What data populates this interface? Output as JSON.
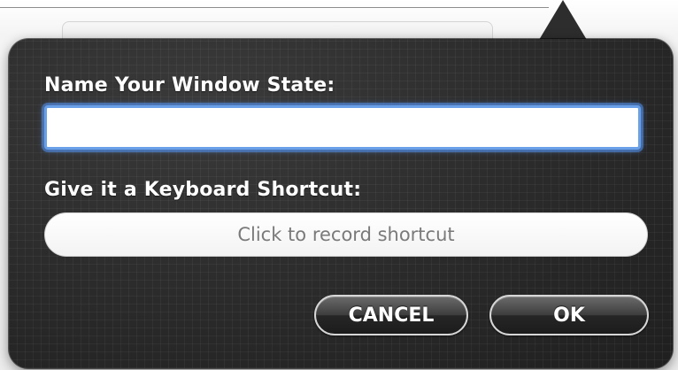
{
  "dialog": {
    "name_label": "Name Your Window State:",
    "name_value": "",
    "name_placeholder": "",
    "shortcut_label": "Give it a Keyboard Shortcut:",
    "shortcut_placeholder": "Click to record shortcut"
  },
  "buttons": {
    "cancel_label": "CANCEL",
    "ok_label": "OK"
  },
  "colors": {
    "hud_background": "#2d2d2d",
    "focus_ring": "#6aa0e8",
    "label_text": "#ffffff",
    "placeholder_text": "#7a7a7a"
  }
}
